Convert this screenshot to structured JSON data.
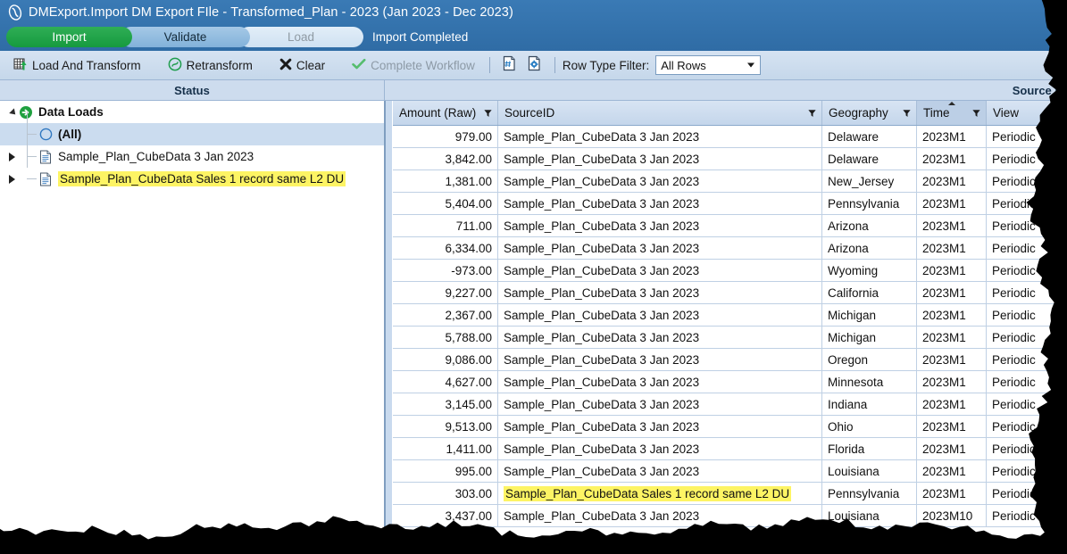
{
  "titlebar": {
    "logo_icon": "dm-logo-icon",
    "title": "DMExport.Import DM Export FIle  -  Transformed_Plan  -  2023 (Jan 2023 - Dec 2023)",
    "steps": [
      {
        "label": "Import",
        "state": "done"
      },
      {
        "label": "Validate",
        "state": "current"
      },
      {
        "label": "Load",
        "state": "pending"
      }
    ],
    "status": "Import Completed",
    "accent_done": "#22a34a",
    "accent_current": "#8fb9dd",
    "accent_pending": "#d6e6f5",
    "bar_color": "#2e6da4"
  },
  "toolbar": {
    "load_and_transform": "Load And Transform",
    "retransform": "Retransform",
    "clear": "Clear",
    "complete_workflow": "Complete Workflow",
    "row_type_filter_label": "Row Type Filter:",
    "row_type_filter_value": "All Rows",
    "icons": {
      "load_and_transform": "grid-up-arrow-icon",
      "retransform": "refresh-circle-icon",
      "clear": "x-mark-icon",
      "complete_workflow": "check-mark-icon",
      "doc_hash": "document-hash-icon",
      "doc_gear": "document-gear-icon"
    }
  },
  "panels": {
    "status_header": "Status",
    "source_info_header": "Source I"
  },
  "tree": {
    "items": [
      {
        "label": "Data Loads",
        "icon": "green-arrow-circle-icon",
        "expander": "expanded",
        "indent": 0,
        "bold": true,
        "selected": false,
        "highlight": false
      },
      {
        "label": "(All)",
        "icon": "blue-circle-icon",
        "expander": "none",
        "indent": 1,
        "bold": true,
        "selected": true,
        "highlight": false
      },
      {
        "label": "Sample_Plan_CubeData 3 Jan 2023",
        "icon": "document-icon",
        "expander": "collapsed",
        "indent": 1,
        "bold": false,
        "selected": false,
        "highlight": false
      },
      {
        "label": "Sample_Plan_CubeData Sales 1 record same L2 DU",
        "icon": "document-icon",
        "expander": "collapsed",
        "indent": 1,
        "bold": false,
        "selected": false,
        "highlight": true
      }
    ]
  },
  "grid": {
    "columns": [
      {
        "key": "amount",
        "label": "Amount (Raw)",
        "filter": true,
        "sorted": false,
        "align": "right"
      },
      {
        "key": "source",
        "label": "SourceID",
        "filter": true,
        "sorted": false,
        "align": "left"
      },
      {
        "key": "geo",
        "label": "Geography",
        "filter": true,
        "sorted": false,
        "align": "left"
      },
      {
        "key": "time",
        "label": "Time",
        "filter": true,
        "sorted": true,
        "sort_dir": "asc",
        "align": "left"
      },
      {
        "key": "view",
        "label": "View",
        "filter": true,
        "sorted": false,
        "align": "left"
      }
    ],
    "rows": [
      {
        "amount": "979.00",
        "source": "Sample_Plan_CubeData 3 Jan 2023",
        "geo": "Delaware",
        "time": "2023M1",
        "view": "Periodic",
        "highlight_source": false
      },
      {
        "amount": "3,842.00",
        "source": "Sample_Plan_CubeData 3 Jan 2023",
        "geo": "Delaware",
        "time": "2023M1",
        "view": "Periodic",
        "highlight_source": false
      },
      {
        "amount": "1,381.00",
        "source": "Sample_Plan_CubeData 3 Jan 2023",
        "geo": "New_Jersey",
        "time": "2023M1",
        "view": "Periodic",
        "highlight_source": false
      },
      {
        "amount": "5,404.00",
        "source": "Sample_Plan_CubeData 3 Jan 2023",
        "geo": "Pennsylvania",
        "time": "2023M1",
        "view": "Periodic",
        "highlight_source": false
      },
      {
        "amount": "711.00",
        "source": "Sample_Plan_CubeData 3 Jan 2023",
        "geo": "Arizona",
        "time": "2023M1",
        "view": "Periodic",
        "highlight_source": false
      },
      {
        "amount": "6,334.00",
        "source": "Sample_Plan_CubeData 3 Jan 2023",
        "geo": "Arizona",
        "time": "2023M1",
        "view": "Periodic",
        "highlight_source": false
      },
      {
        "amount": "-973.00",
        "source": "Sample_Plan_CubeData 3 Jan 2023",
        "geo": "Wyoming",
        "time": "2023M1",
        "view": "Periodic",
        "highlight_source": false
      },
      {
        "amount": "9,227.00",
        "source": "Sample_Plan_CubeData 3 Jan 2023",
        "geo": "California",
        "time": "2023M1",
        "view": "Periodic",
        "highlight_source": false
      },
      {
        "amount": "2,367.00",
        "source": "Sample_Plan_CubeData 3 Jan 2023",
        "geo": "Michigan",
        "time": "2023M1",
        "view": "Periodic",
        "highlight_source": false
      },
      {
        "amount": "5,788.00",
        "source": "Sample_Plan_CubeData 3 Jan 2023",
        "geo": "Michigan",
        "time": "2023M1",
        "view": "Periodic",
        "highlight_source": false
      },
      {
        "amount": "9,086.00",
        "source": "Sample_Plan_CubeData 3 Jan 2023",
        "geo": "Oregon",
        "time": "2023M1",
        "view": "Periodic",
        "highlight_source": false
      },
      {
        "amount": "4,627.00",
        "source": "Sample_Plan_CubeData 3 Jan 2023",
        "geo": "Minnesota",
        "time": "2023M1",
        "view": "Periodic",
        "highlight_source": false
      },
      {
        "amount": "3,145.00",
        "source": "Sample_Plan_CubeData 3 Jan 2023",
        "geo": "Indiana",
        "time": "2023M1",
        "view": "Periodic",
        "highlight_source": false
      },
      {
        "amount": "9,513.00",
        "source": "Sample_Plan_CubeData 3 Jan 2023",
        "geo": "Ohio",
        "time": "2023M1",
        "view": "Periodic",
        "highlight_source": false
      },
      {
        "amount": "1,411.00",
        "source": "Sample_Plan_CubeData 3 Jan 2023",
        "geo": "Florida",
        "time": "2023M1",
        "view": "Periodic",
        "highlight_source": false
      },
      {
        "amount": "995.00",
        "source": "Sample_Plan_CubeData 3 Jan 2023",
        "geo": "Louisiana",
        "time": "2023M1",
        "view": "Periodic",
        "highlight_source": false
      },
      {
        "amount": "303.00",
        "source": "Sample_Plan_CubeData Sales 1 record same L2 DU",
        "geo": "Pennsylvania",
        "time": "2023M1",
        "view": "Periodic",
        "highlight_source": true
      },
      {
        "amount": "3,437.00",
        "source": "Sample_Plan_CubeData 3 Jan 2023",
        "geo": "Louisiana",
        "time": "2023M10",
        "view": "Periodic",
        "highlight_source": false
      }
    ],
    "highlight_color": "#fdf464"
  }
}
